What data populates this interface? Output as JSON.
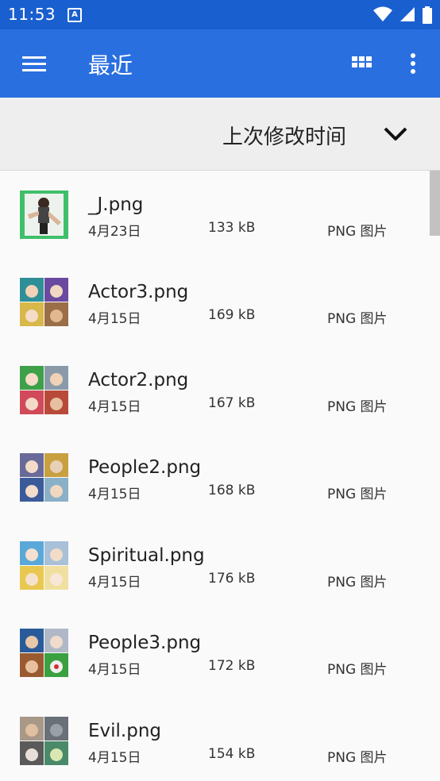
{
  "status_bar": {
    "time": "11:53",
    "notification_icon": "A"
  },
  "app_bar": {
    "title": "最近",
    "icons": [
      "menu-icon",
      "grid-view-icon",
      "more-vert-icon"
    ],
    "color": "#2a6fe0"
  },
  "sort": {
    "label": "上次修改时间",
    "icon": "chevron-down-icon"
  },
  "files": [
    {
      "name": "_J.png",
      "date": "4月23日",
      "size": "133 kB",
      "type": "PNG 图片"
    },
    {
      "name": "Actor3.png",
      "date": "4月15日",
      "size": "169 kB",
      "type": "PNG 图片"
    },
    {
      "name": "Actor2.png",
      "date": "4月15日",
      "size": "167 kB",
      "type": "PNG 图片"
    },
    {
      "name": "People2.png",
      "date": "4月15日",
      "size": "168 kB",
      "type": "PNG 图片"
    },
    {
      "name": "Spiritual.png",
      "date": "4月15日",
      "size": "176 kB",
      "type": "PNG 图片"
    },
    {
      "name": "People3.png",
      "date": "4月15日",
      "size": "172 kB",
      "type": "PNG 图片"
    },
    {
      "name": "Evil.png",
      "date": "4月15日",
      "size": "154 kB",
      "type": "PNG 图片"
    }
  ]
}
